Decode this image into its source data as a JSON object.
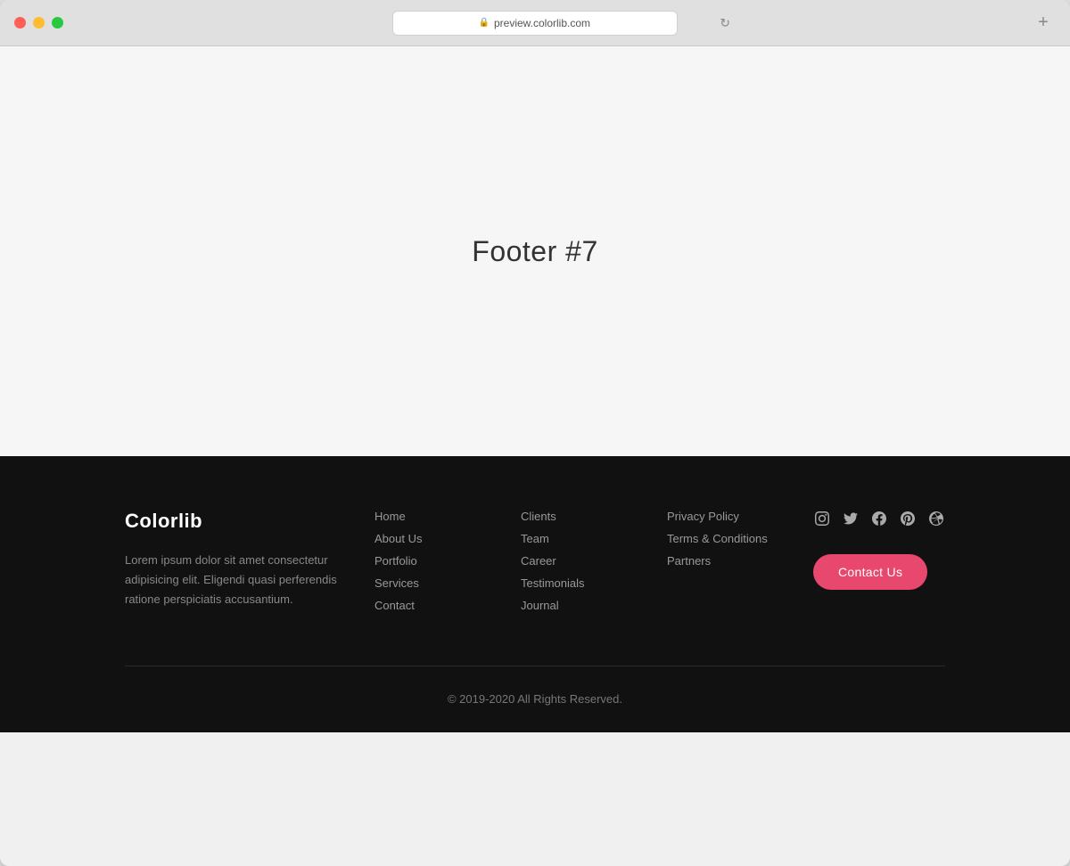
{
  "browser": {
    "url": "preview.colorlib.com",
    "new_tab_label": "+",
    "refresh_label": "↻"
  },
  "page": {
    "title": "Footer #7"
  },
  "footer": {
    "brand": {
      "logo": "Colorlib",
      "description": "Lorem ipsum dolor sit amet consectetur adipisicing elit. Eligendi quasi perferendis ratione perspiciatis accusantium."
    },
    "nav_col1": {
      "links": [
        "Home",
        "About Us",
        "Portfolio",
        "Services",
        "Contact"
      ]
    },
    "nav_col2": {
      "links": [
        "Clients",
        "Team",
        "Career",
        "Testimonials",
        "Journal"
      ]
    },
    "nav_col3": {
      "links": [
        "Privacy Policy",
        "Terms & Conditions",
        "Partners"
      ]
    },
    "social": {
      "icons": [
        "instagram-icon",
        "twitter-icon",
        "facebook-icon",
        "pinterest-icon",
        "dribbble-icon"
      ]
    },
    "contact_button": "Contact Us",
    "copyright": "© 2019-2020 All Rights Reserved."
  }
}
